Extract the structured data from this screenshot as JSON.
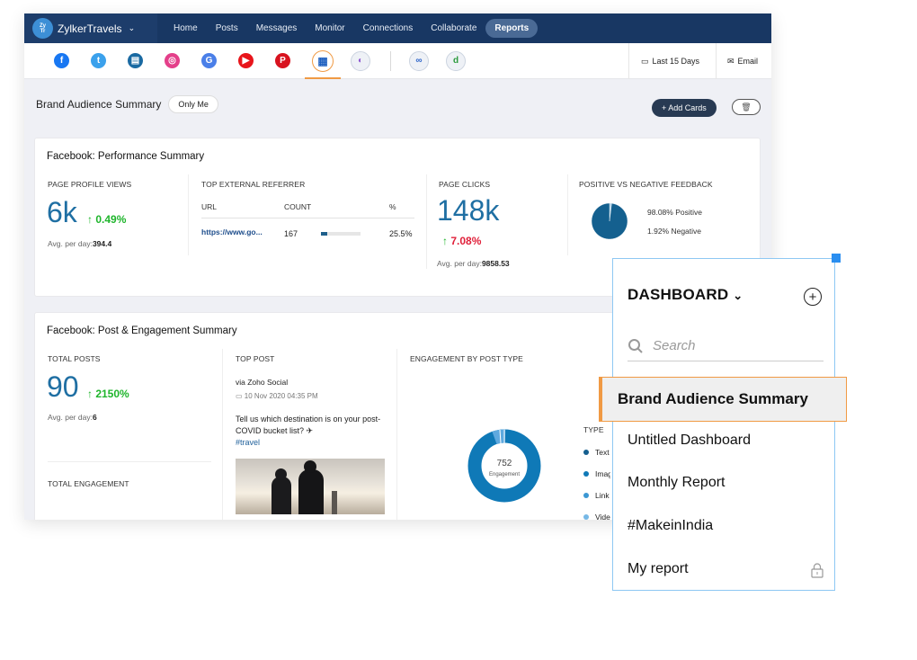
{
  "app": {
    "brand_name": "ZylkerTravels",
    "brand_logo_text": "Zylker Travels",
    "nav": [
      "Home",
      "Posts",
      "Messages",
      "Monitor",
      "Connections",
      "Collaborate",
      "Reports"
    ],
    "active_nav": "Reports"
  },
  "networks": [
    {
      "name": "facebook",
      "glyph": "f",
      "color": "#1877f2"
    },
    {
      "name": "twitter",
      "glyph": "t",
      "color": "#3ba1ec"
    },
    {
      "name": "linkedin-page",
      "glyph": "▤",
      "color": "#1a6aa2"
    },
    {
      "name": "instagram",
      "glyph": "◎",
      "color": "#e43f8a"
    },
    {
      "name": "google-my-business",
      "glyph": "G",
      "color": "#4a7fe8"
    },
    {
      "name": "youtube",
      "glyph": "▶",
      "color": "#e8151b"
    },
    {
      "name": "pinterest",
      "glyph": "P",
      "color": "#d8131f"
    },
    {
      "name": "dashboard",
      "glyph": "▦",
      "color": "#1e5fbf"
    },
    {
      "name": "zoho-crm",
      "glyph": "◐",
      "color": "#8e5ad1"
    },
    {
      "name": "zoho-desk",
      "glyph": "∞",
      "color": "#2b63c9"
    },
    {
      "name": "zoho-bookings",
      "glyph": "d",
      "color": "#2a9a3c"
    }
  ],
  "toolbar": {
    "date_range": "Last 15 Days",
    "email": "Email"
  },
  "page": {
    "title": "Brand Audience Summary",
    "visibility": "Only Me",
    "add_cards": "+ Add Cards"
  },
  "performance": {
    "title": "Facebook: Performance Summary",
    "page_profile_views": {
      "label": "PAGE PROFILE VIEWS",
      "value": "6k",
      "delta": "↑ 0.49%",
      "avg_label": "Avg. per day:",
      "avg": "394.4"
    },
    "referrer": {
      "label": "TOP EXTERNAL REFERRER",
      "columns": [
        "URL",
        "COUNT",
        "%"
      ],
      "rows": [
        {
          "url": "https://www.go...",
          "count": "167",
          "share": 0.255,
          "percent": "25.5%"
        }
      ]
    },
    "page_clicks": {
      "label": "PAGE CLICKS",
      "value": "148k",
      "delta_arrow": "↑",
      "delta": "7.08%",
      "avg_label": "Avg. per day:",
      "avg": "9858.53"
    },
    "feedback": {
      "label": "POSITIVE VS NEGATIVE FEEDBACK",
      "positive_pct": 98.08,
      "negative_pct": 1.92,
      "positive_text": "98.08%  Positive",
      "negative_text": "1.92%  Negative",
      "colors": {
        "positive": "#14608f",
        "negative": "#a8cde6"
      }
    }
  },
  "engagement": {
    "title": "Facebook: Post & Engagement Summary",
    "total_posts": {
      "label": "TOTAL POSTS",
      "value": "90",
      "delta": "↑ 2150%",
      "avg_label": "Avg. per day:",
      "avg": "6"
    },
    "total_engagement_label": "TOTAL ENGAGEMENT",
    "top_post": {
      "label": "TOP POST",
      "via": "via Zoho Social",
      "date": "10 Nov 2020 04:35 PM",
      "text": "Tell us which destination is on your post-COVID bucket list? ✈",
      "hashtag": "#travel"
    },
    "by_type": {
      "label": "ENGAGEMENT BY POST TYPE",
      "center_value": "752",
      "center_label": "Engagement",
      "type_header": "TYPE",
      "legend": [
        "Text",
        "Image",
        "Link",
        "Video"
      ]
    }
  },
  "chart_data": {
    "type": "pie",
    "title": "POSITIVE VS NEGATIVE FEEDBACK",
    "categories": [
      "Positive",
      "Negative"
    ],
    "values": [
      98.08,
      1.92
    ]
  },
  "dropdown": {
    "title": "DASHBOARD",
    "search_placeholder": "Search",
    "items": [
      "Brand Audience Summary",
      "Untitled Dashboard",
      "Monthly Report",
      "#MakeinIndia",
      "My report"
    ],
    "active": "Brand Audience Summary",
    "locked_item": "My report"
  }
}
